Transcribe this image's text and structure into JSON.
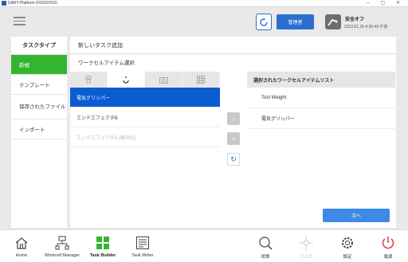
{
  "titlebar": {
    "title": "DART-Platform GV0207010"
  },
  "header": {
    "role_label": "管理者",
    "safety_label": "安全オフ",
    "timestamp": "2022.01.25 4:35:49 午後",
    "icons": [
      "menu-icon",
      "sync-icon",
      "safety-robot-icon"
    ]
  },
  "sidebar": {
    "title": "タスクタイプ",
    "items": [
      {
        "label": "新規",
        "active": true
      },
      {
        "label": "テンプレート",
        "active": false
      },
      {
        "label": "保存されたファイル",
        "active": false
      },
      {
        "label": "インポート",
        "active": false
      }
    ]
  },
  "panel": {
    "title": "新しいタスク追加",
    "subtitle": "ワークセルアイテム選択",
    "tabs": [
      {
        "icon": "robot-icon"
      },
      {
        "icon": "gripper-icon",
        "active": true
      },
      {
        "icon": "camera-icon"
      },
      {
        "icon": "grid-icon"
      }
    ],
    "list": [
      {
        "label": "電気グリッパー",
        "state": "selected"
      },
      {
        "label": "エンドエフェクタB",
        "state": "normal"
      },
      {
        "label": "エンドエフェクタA (無効化)",
        "state": "disabled"
      }
    ],
    "selected_header": "選択されたワークセルアイテムリスト",
    "selected_items": [
      "Tool Weight",
      "電気グリッパー"
    ],
    "next_label": "次へ"
  },
  "bottomnav": {
    "items": [
      {
        "label": "Home",
        "icon": "home-icon"
      },
      {
        "label": "Workcell Manager",
        "icon": "workcell-icon"
      },
      {
        "label": "Task Builder",
        "icon": "task-builder-icon"
      },
      {
        "label": "Task Writer",
        "icon": "task-writer-icon"
      },
      {
        "label": "状態",
        "icon": "status-icon"
      },
      {
        "label": "ジョグ",
        "icon": "jog-icon"
      },
      {
        "label": "設定",
        "icon": "settings-icon"
      },
      {
        "label": "電源",
        "icon": "power-icon"
      }
    ]
  },
  "colors": {
    "accent": "#2a6fcf",
    "active_green": "#34b431",
    "selected_blue": "#0b5cd1",
    "power_red": "#e23b3b"
  }
}
